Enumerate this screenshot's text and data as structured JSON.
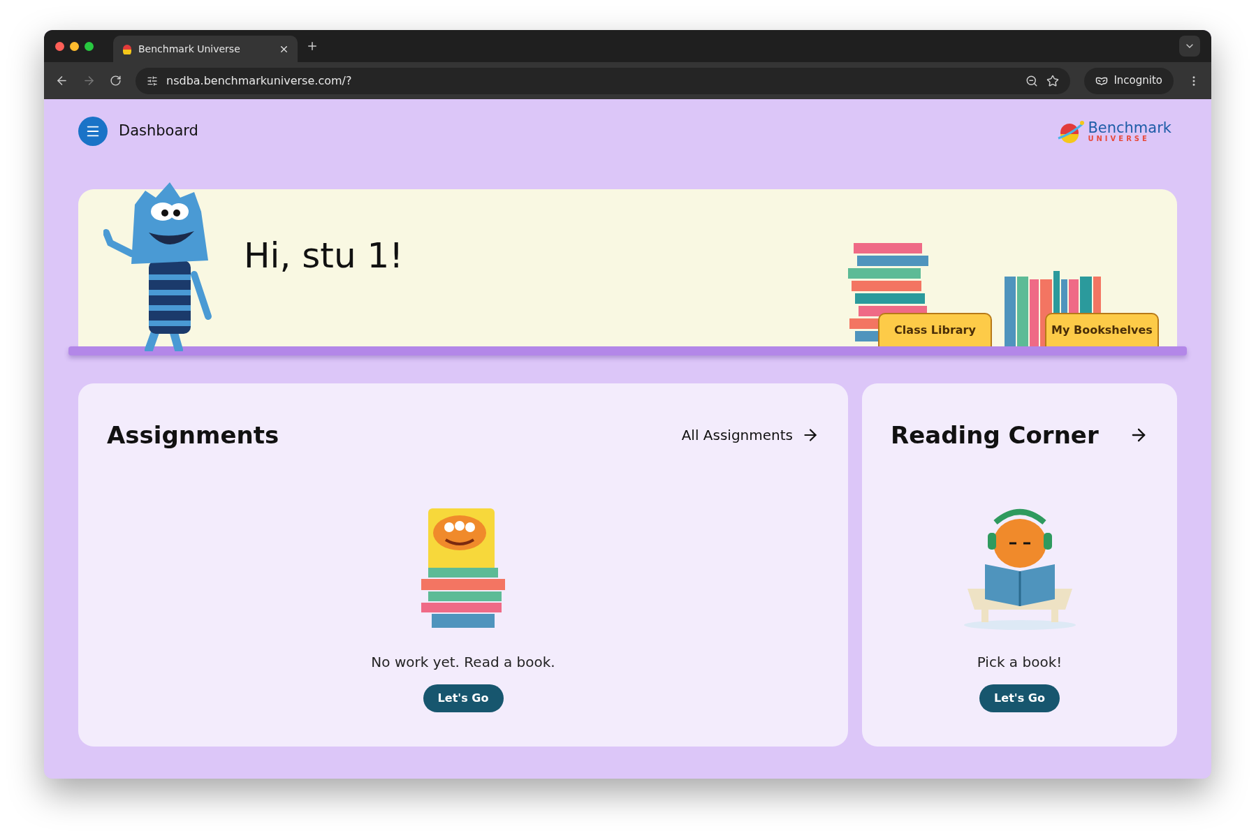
{
  "browser": {
    "tab_title": "Benchmark Universe",
    "url": "nsdba.benchmarkuniverse.com/?",
    "profile": "Incognito"
  },
  "header": {
    "title": "Dashboard",
    "logo_top": "Benchmark",
    "logo_bottom": "UNIVERSE"
  },
  "banner": {
    "greeting": "Hi, stu 1!",
    "buttons": [
      "Class Library",
      "My Bookshelves"
    ]
  },
  "cards": [
    {
      "kind": "assignments",
      "title": "Assignments",
      "link": "All Assignments",
      "message": "No work yet. Read a book.",
      "button": "Let's Go"
    },
    {
      "kind": "reading",
      "title": "Reading Corner",
      "message": "Pick a book!",
      "button": "Let's Go"
    }
  ]
}
